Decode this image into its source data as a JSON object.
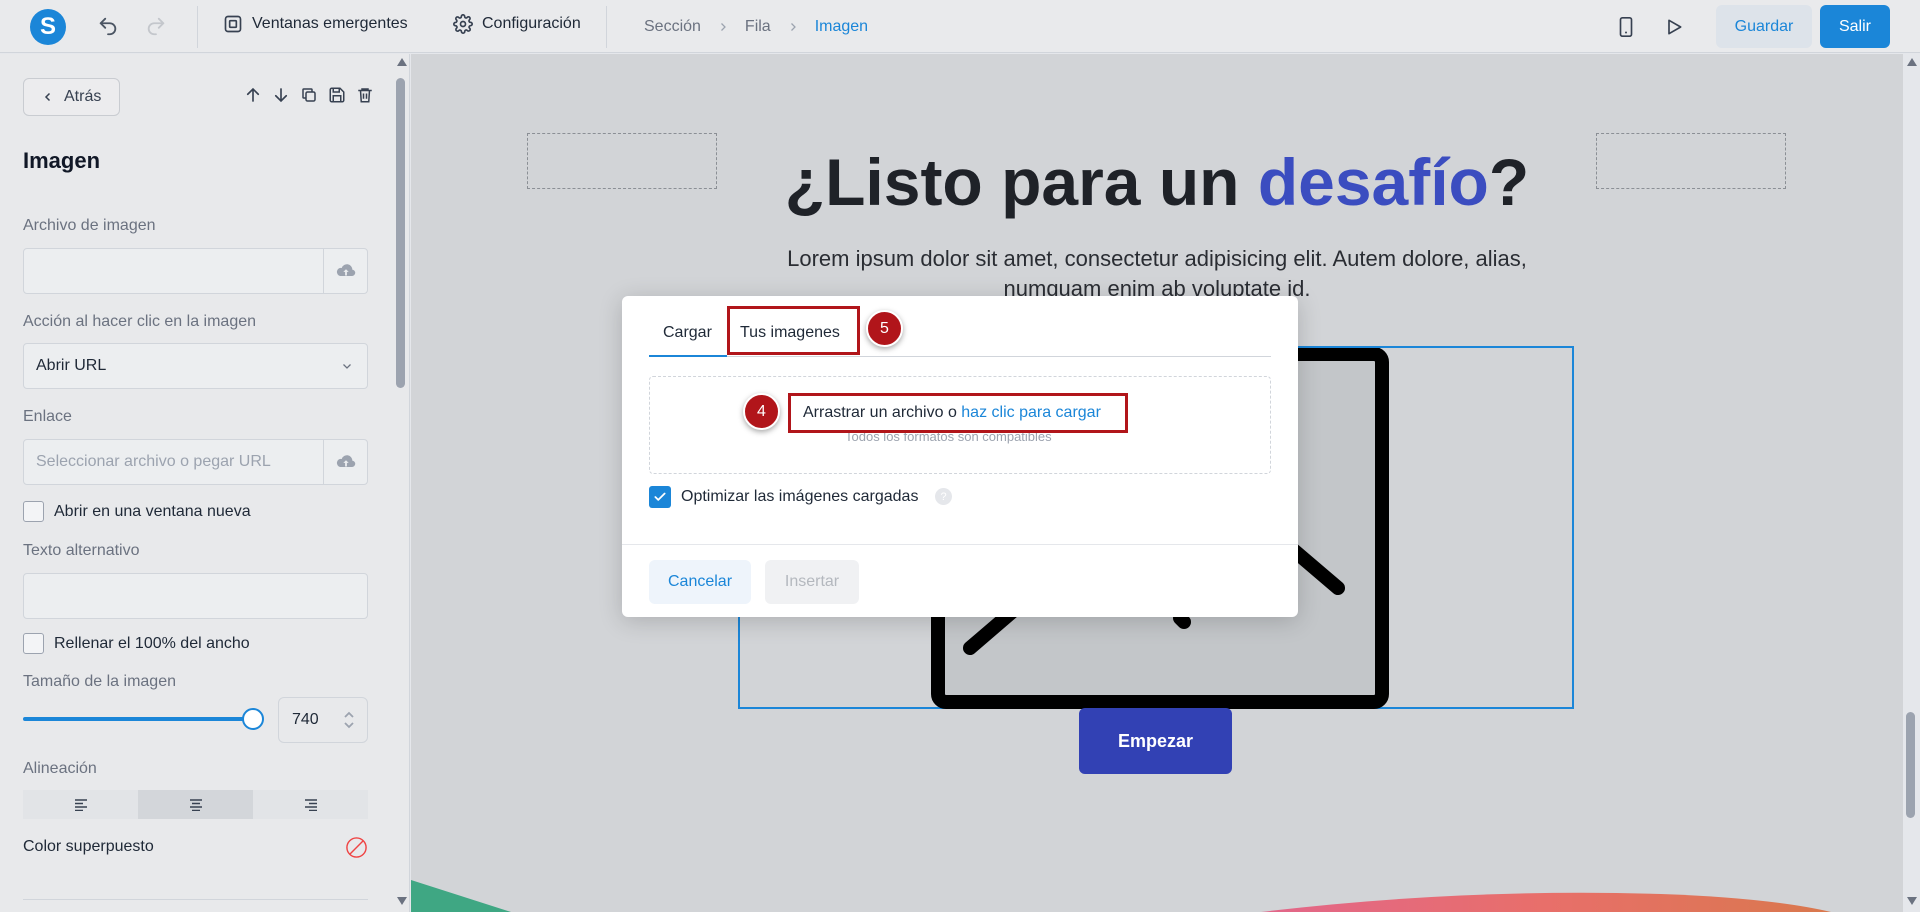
{
  "topbar": {
    "logo_letter": "S",
    "menu": {
      "popups": "Ventanas emergentes",
      "settings": "Configuración"
    },
    "breadcrumb": [
      "Sección",
      "Fila",
      "Imagen"
    ],
    "save_label": "Guardar",
    "exit_label": "Salir"
  },
  "sidebar": {
    "back_label": "Atrás",
    "title": "Imagen",
    "image_file_label": "Archivo de imagen",
    "image_file_value": "",
    "click_action_label": "Acción al hacer clic en la imagen",
    "click_action_value": "Abrir URL",
    "link_label": "Enlace",
    "link_placeholder": "Seleccionar archivo o pegar URL",
    "open_new_window_label": "Abrir en una ventana nueva",
    "open_new_window_checked": false,
    "alt_text_label": "Texto alternativo",
    "alt_text_value": "",
    "fill_width_label": "Rellenar el 100% del ancho",
    "fill_width_checked": false,
    "image_size_label": "Tamaño de la imagen",
    "image_size_value": "740",
    "image_size_fraction": 1.0,
    "alignment_label": "Alineación",
    "alignment_options": [
      "left",
      "center",
      "right"
    ],
    "alignment_selected": "center",
    "overlay_color_label": "Color superpuesto"
  },
  "canvas": {
    "hero_title_before": "¿Listo para un ",
    "hero_title_accent": "desafío",
    "hero_title_after": "?",
    "hero_subtitle": "Lorem ipsum dolor sit amet, consectetur adipisicing elit. Autem dolore, alias, numquam enim ab voluptate id.",
    "cta_label": "Empezar",
    "accent_color": "#3b4dc0"
  },
  "modal": {
    "tabs": [
      "Cargar",
      "Tus imagenes"
    ],
    "active_tab": "Cargar",
    "drop_text": "Arrastrar un archivo o ",
    "drop_link": "haz clic para cargar",
    "drop_sub": "Todos los formatos son compatibles",
    "optimize_label": "Optimizar las imágenes cargadas",
    "optimize_checked": true,
    "cancel_label": "Cancelar",
    "insert_label": "Insertar"
  },
  "annotations": {
    "step_4": "4",
    "step_5": "5",
    "highlight_color": "#b1151a"
  },
  "colors": {
    "primary": "#1b86d8",
    "cta": "#3241b4"
  }
}
